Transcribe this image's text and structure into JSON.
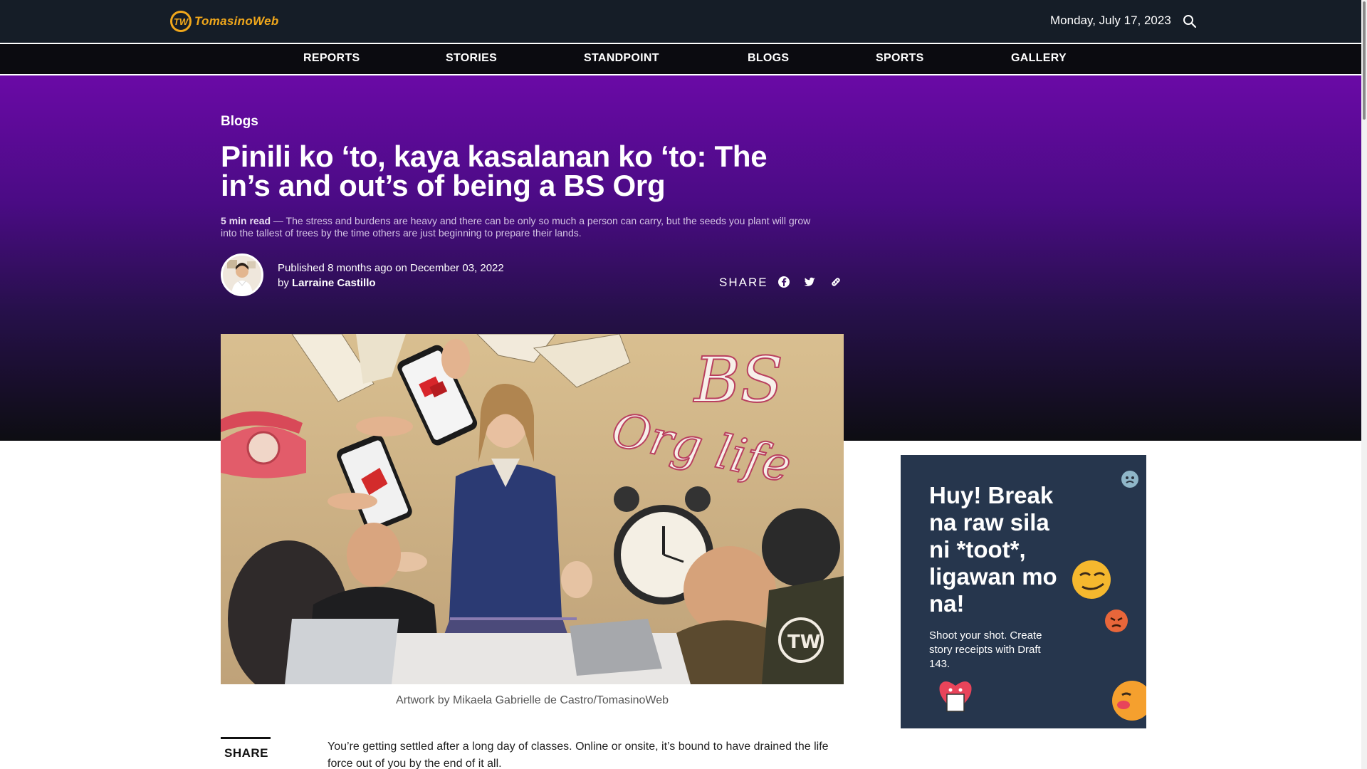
{
  "header": {
    "logo_mark": "TW",
    "logo_text": "TomasinoWeb",
    "date": "Monday, July 17, 2023",
    "search_icon": "search-icon"
  },
  "nav": {
    "items": [
      "REPORTS",
      "STORIES",
      "STANDPOINT",
      "BLOGS",
      "SPORTS",
      "GALLERY"
    ]
  },
  "article": {
    "category": "Blogs",
    "title": "Pinili ko ‘to, kaya kasalanan ko ‘to: The in’s and out’s of being a BS Org",
    "read_time": "5 min read",
    "summary": " — The stress and burdens are heavy and there can be only so much a person can carry, but the seeds you plant will grow into the tallest of trees by the time others are just beginning to prepare their lands.",
    "published_prefix": "Published ",
    "published_ago": "8 months ago",
    "published_on": " on December 03, 2022",
    "by_prefix": "by ",
    "author": "Larraine Castillo",
    "share_label": "SHARE",
    "share_icons": [
      "facebook-icon",
      "twitter-icon",
      "link-icon"
    ],
    "image_text_line1": "BS",
    "image_text_line2": "Org life",
    "image_watermark": "TW",
    "caption": "Artwork by Mikaela Gabrielle de Castro/TomasinoWeb",
    "share_bottom_label": "SHARE",
    "body_first_paragraph": "You’re getting settled after a long day of classes. Online or onsite, it’s bound to have drained the life force out of you by the end of it all."
  },
  "ad": {
    "headline": "Huy! Break na raw sila ni *toot*, ligawan mo na!",
    "subtext": "Shoot your shot. Create story receipts with Draft 143.",
    "colors": {
      "background": "#26364d",
      "emoji": "#f5b82e"
    }
  },
  "colors": {
    "topbar": "#151d27",
    "accent": "#f0a71b",
    "hero_top": "#6a0aa6",
    "hero_bottom": "#0d0d12"
  }
}
